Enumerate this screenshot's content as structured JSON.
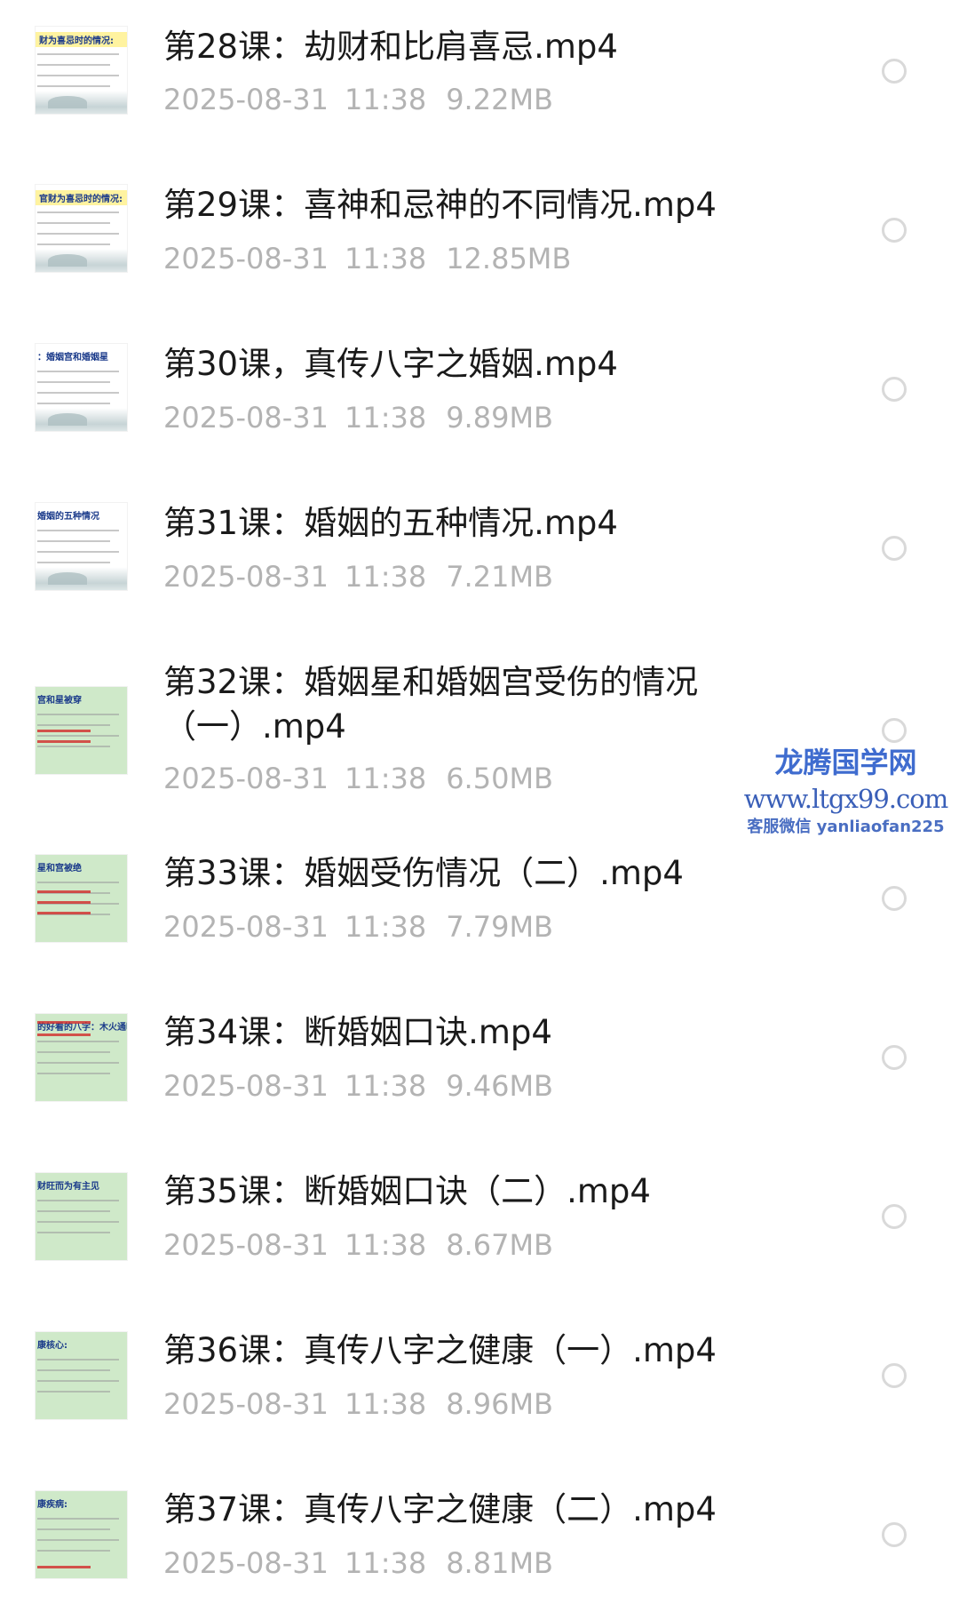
{
  "files": [
    {
      "title": "第28课：劫财和比肩喜忌.mp4",
      "date": "2025-08-31",
      "time": "11:38",
      "size": "9.22MB",
      "thumb_text": "财为喜忌时的情况:"
    },
    {
      "title": "第29课：喜神和忌神的不同情况.mp4",
      "date": "2025-08-31",
      "time": "11:38",
      "size": "12.85MB",
      "thumb_text": "官财为喜忌时的情况:"
    },
    {
      "title": "第30课，真传八字之婚姻.mp4",
      "date": "2025-08-31",
      "time": "11:38",
      "size": "9.89MB",
      "thumb_text": "：婚姻宫和婚姻星"
    },
    {
      "title": "第31课：婚姻的五种情况.mp4",
      "date": "2025-08-31",
      "time": "11:38",
      "size": "7.21MB",
      "thumb_text": "婚姻的五种情况"
    },
    {
      "title": "第32课：婚姻星和婚姻宫受伤的情况（一）.mp4",
      "date": "2025-08-31",
      "time": "11:38",
      "size": "6.50MB",
      "thumb_text": "宫和星被穿"
    },
    {
      "title": "第33课：婚姻受伤情况（二）.mp4",
      "date": "2025-08-31",
      "time": "11:38",
      "size": "7.79MB",
      "thumb_text": "星和宫被绝"
    },
    {
      "title": "第34课：断婚姻口诀.mp4",
      "date": "2025-08-31",
      "time": "11:38",
      "size": "9.46MB",
      "thumb_text": "的好看的八字：木火通明"
    },
    {
      "title": "第35课：断婚姻口诀（二）.mp4",
      "date": "2025-08-31",
      "time": "11:38",
      "size": "8.67MB",
      "thumb_text": "财旺而为有主见"
    },
    {
      "title": "第36课：真传八字之健康（一）.mp4",
      "date": "2025-08-31",
      "time": "11:38",
      "size": "8.96MB",
      "thumb_text": "康核心:"
    },
    {
      "title": "第37课：真传八字之健康（二）.mp4",
      "date": "2025-08-31",
      "time": "11:38",
      "size": "8.81MB",
      "thumb_text": "康疾病:"
    }
  ],
  "watermark": {
    "name": "龙腾国学网",
    "url": "www.ltgx99.com",
    "contact": "客服微信 yanliaofan225"
  }
}
